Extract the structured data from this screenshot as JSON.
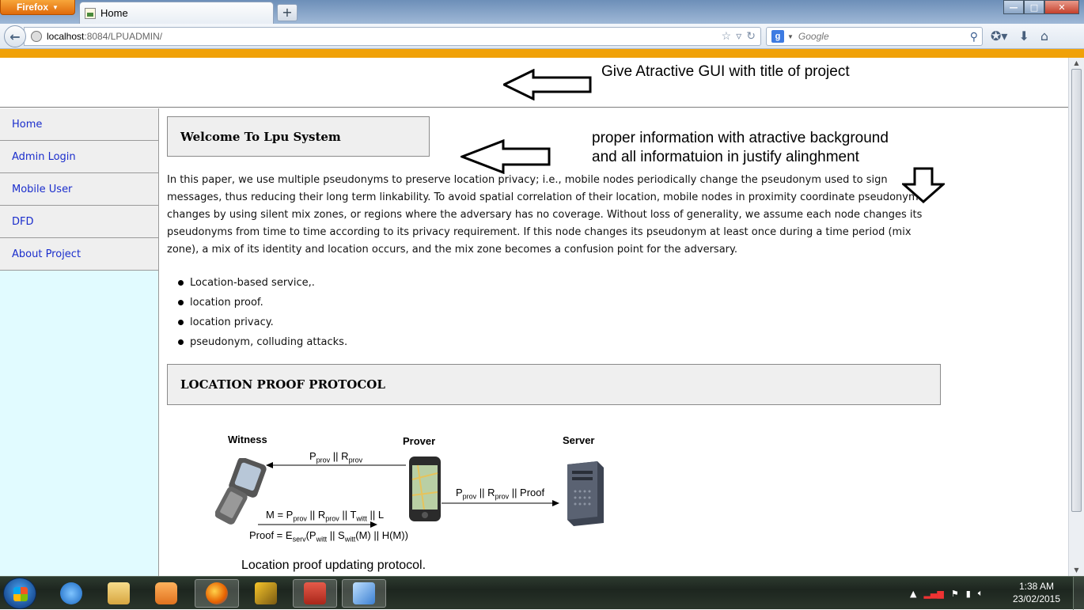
{
  "browser": {
    "menu_label": "Firefox",
    "tab_title": "Home",
    "new_tab": "+",
    "url_host": "localhost",
    "url_rest": ":8084/LPUADMIN/",
    "search_placeholder": "Google",
    "search_engine_letter": "g"
  },
  "page": {
    "annotations": {
      "header_note": "Give Atractive GUI with title of project",
      "content_note_line1": "proper information with atractive background",
      "content_note_line2": "and all informatuion in justify alinghment"
    },
    "sidebar": {
      "items": [
        {
          "label": "Home"
        },
        {
          "label": "Admin Login"
        },
        {
          "label": "Mobile User"
        },
        {
          "label": "DFD"
        },
        {
          "label": "About Project"
        }
      ]
    },
    "welcome_heading": "Welcome To Lpu System",
    "intro_text": "In this paper, we use multiple pseudonyms to preserve location privacy; i.e., mobile nodes periodically change the pseudonym used to sign messages, thus reducing their long term linkability. To avoid spatial correlation of their location, mobile nodes in proximity coordinate pseudonym changes by using silent mix zones, or regions where the adversary has no coverage. Without loss of generality, we assume each node changes its pseudonyms from time to time according to its privacy requirement. If this node changes its pseudonym at least once during a time period (mix zone), a mix of its identity and location occurs, and the mix zone becomes a confusion point for the adversary.",
    "keywords": [
      "Location-based service,.",
      "location proof.",
      "location privacy.",
      "pseudonym, colluding attacks."
    ],
    "protocol_heading": "LOCATION PROOF PROTOCOL",
    "diagram": {
      "witness_label": "Witness",
      "prover_label": "Prover",
      "server_label": "Server",
      "caption": "Location proof updating protocol."
    }
  },
  "taskbar": {
    "time": "1:38 AM",
    "date": "23/02/2015"
  },
  "colors": {
    "accent_bar": "#f0a108",
    "sidebar_bg": "#e1fbff",
    "link": "#1a2dcc"
  }
}
